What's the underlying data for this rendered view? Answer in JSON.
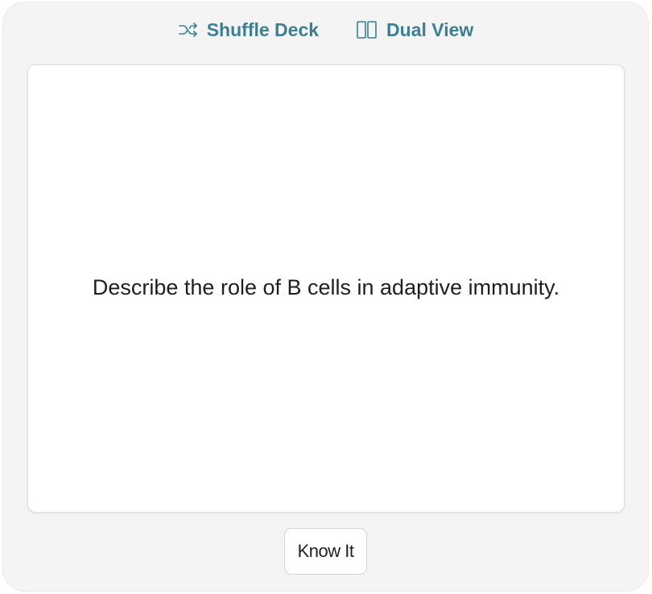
{
  "toolbar": {
    "shuffle_label": "Shuffle Deck",
    "shuffle_icon": "shuffle-icon",
    "dual_label": "Dual View",
    "dual_icon": "columns-icon",
    "accent_color": "#3b7f93"
  },
  "card": {
    "prompt": "Describe the role of B cells in adaptive immunity."
  },
  "actions": {
    "know_it_label": "Know It"
  }
}
